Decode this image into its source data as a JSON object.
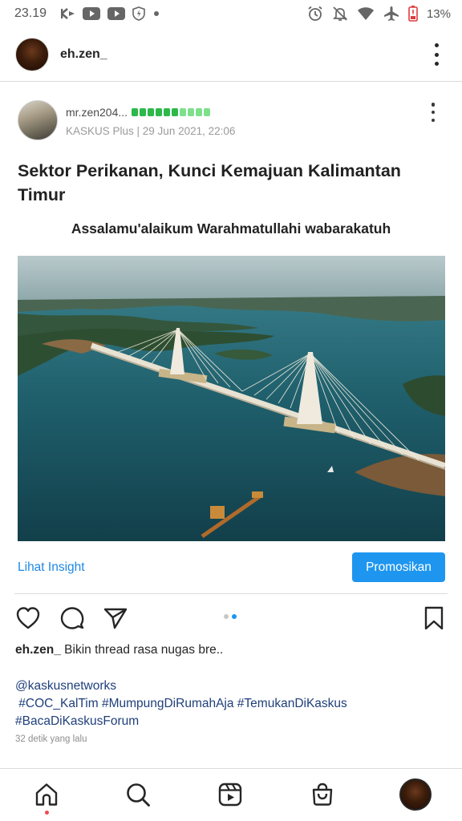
{
  "status_bar": {
    "time": "23.19",
    "battery_percent": "13%",
    "left_icons": [
      "kinemaster-icon",
      "youtube-icon",
      "youtube-icon",
      "shield-icon",
      "dot-icon"
    ],
    "right_icons": [
      "alarm-icon",
      "bell-off-icon",
      "wifi-icon",
      "airplane-icon",
      "battery-low-icon"
    ]
  },
  "profile": {
    "username": "eh.zen_"
  },
  "post": {
    "author": "mr.zen204...",
    "reputation": {
      "filled": 6,
      "total": 10,
      "colors": {
        "dark": "#2db84a",
        "light": "#7ee08d"
      }
    },
    "meta": "KASKUS Plus | 29 Jun 2021, 22:06",
    "title": "Sektor Perikanan, Kunci Kemajuan Kalimantan Timur",
    "greeting": "Assalamu'alaikum Warahmatullahi wabarakatuh",
    "image": "cable-stayed bridge over bay, aerial view"
  },
  "actions": {
    "insight_label": "Lihat Insight",
    "promote_label": "Promosikan",
    "carousel": {
      "count": 2,
      "active_index": 1
    }
  },
  "caption": {
    "username": "eh.zen_",
    "text": "Bikin thread rasa nugas bre..",
    "hashtag_lines": [
      "@kaskusnetworks",
      " #COC_KalTim #MumpungDiRumahAja #TemukanDiKaskus",
      "#BacaDiKaskusForum"
    ],
    "time_ago": "32 detik yang lalu"
  },
  "bottom_nav": [
    "home-icon",
    "search-icon",
    "reels-icon",
    "shop-icon",
    "profile-avatar"
  ],
  "colors": {
    "accent_blue": "#1e96f0",
    "link_blue": "#1e88e5",
    "notification_red": "#ed4956"
  }
}
